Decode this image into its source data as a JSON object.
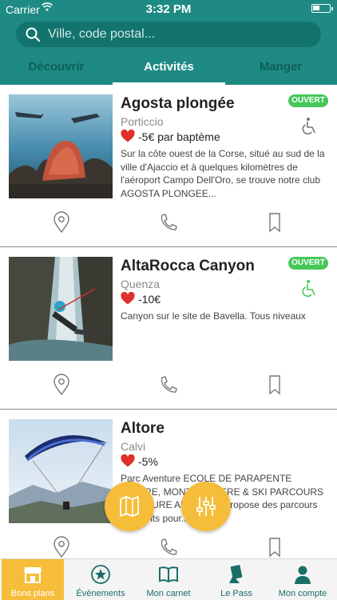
{
  "status_bar": {
    "carrier": "Carrier",
    "time": "3:32 PM"
  },
  "search": {
    "placeholder": "Ville, code postal..."
  },
  "tabs": [
    {
      "label": "Découvrir",
      "active": false
    },
    {
      "label": "Activités",
      "active": true
    },
    {
      "label": "Manger",
      "active": false
    }
  ],
  "listings": [
    {
      "title": "Agosta plongée",
      "city": "Porticcio",
      "deal": "-5€ par baptème",
      "description": "Sur la côte ouest de la Corse, situé au sud de la ville d'Ajaccio et à quelques kilomètres de l'aéroport Campo Dell'Oro, se trouve notre club AGOSTA PLONGEE...",
      "badge": "OUVERT",
      "accessible": true
    },
    {
      "title": "AltaRocca Canyon",
      "city": "Quenza",
      "deal": "-10€",
      "description": "Canyon sur le site de Bavella. Tous niveaux",
      "badge": "OUVERT",
      "accessible": true
    },
    {
      "title": "Altore",
      "city": "Calvi",
      "deal": "-5%",
      "description": "Parc Aventure ECOLE DE PARAPENTE ALTORE, MONTGOLFIERE & SKI PARCOURS AVENTURE Altore vous propose des parcours différents pour..."
    }
  ],
  "bottom_nav": [
    {
      "label": "Bons plans",
      "icon": "shop-icon",
      "active": true
    },
    {
      "label": "Évènements",
      "icon": "star-badge-icon",
      "active": false
    },
    {
      "label": "Mon carnet",
      "icon": "open-book-icon",
      "active": false
    },
    {
      "label": "Le Pass",
      "icon": "hand-card-icon",
      "active": false
    },
    {
      "label": "Mon compte",
      "icon": "user-icon",
      "active": false
    }
  ],
  "colors": {
    "primary": "#1e8a83",
    "primary_dark": "#13736d",
    "accent": "#f5bd3a",
    "badge_green": "#46c75a",
    "heart_red": "#e0302b"
  }
}
